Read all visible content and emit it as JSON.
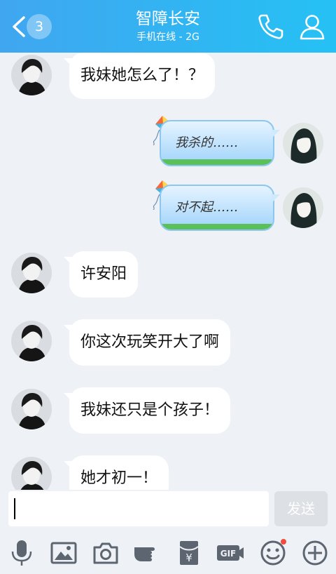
{
  "header": {
    "back_badge": "3",
    "title": "智障长安",
    "subtitle": "手机在线 - 2G"
  },
  "messages": [
    {
      "side": "left",
      "text": "我妹她怎么了！？"
    },
    {
      "side": "right",
      "text": "我杀的……"
    },
    {
      "side": "right",
      "text": "对不起……"
    },
    {
      "side": "left",
      "text": "许安阳"
    },
    {
      "side": "left",
      "text": "你这次玩笑开大了啊"
    },
    {
      "side": "left",
      "text": "我妹还只是个孩子！"
    },
    {
      "side": "left",
      "text": "她才初一！"
    }
  ],
  "input": {
    "value": "",
    "send_label": "发送"
  },
  "toolbar": {
    "icons": [
      "microphone-icon",
      "image-icon",
      "camera-icon",
      "hand-icon",
      "red-packet-icon",
      "gif-icon",
      "emoji-icon",
      "plus-icon"
    ],
    "gif_label": "GIF",
    "yen_label": "¥"
  },
  "colors": {
    "header_start": "#40a6f0",
    "header_end": "#25c1f4",
    "chat_bg": "#eef1f6",
    "send_disabled": "#dde0e4",
    "notification_dot": "#f04b3c"
  }
}
